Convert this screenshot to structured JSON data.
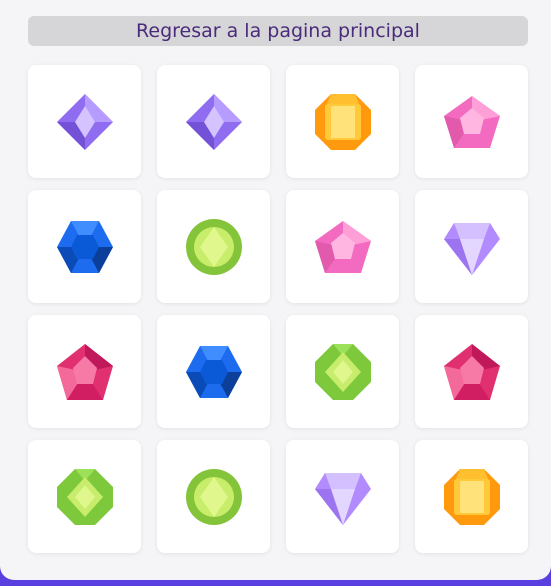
{
  "back_button": {
    "label": "Regresar a la pagina principal"
  },
  "colors": {
    "background": "#5a3fe0",
    "panel": "#f5f5f7",
    "button_bg": "#d6d6d8",
    "button_text": "#4a2a7a",
    "card": "#ffffff"
  },
  "cards": [
    {
      "gem": "purple-diamond-gem"
    },
    {
      "gem": "purple-diamond-gem"
    },
    {
      "gem": "orange-octagon-gem"
    },
    {
      "gem": "pink-pentagon-gem"
    },
    {
      "gem": "blue-hexagon-gem"
    },
    {
      "gem": "green-round-gem"
    },
    {
      "gem": "pink-pentagon-gem"
    },
    {
      "gem": "lavender-heart-gem"
    },
    {
      "gem": "crimson-pentagon-gem"
    },
    {
      "gem": "blue-hexagon-gem"
    },
    {
      "gem": "green-octagon-gem"
    },
    {
      "gem": "crimson-pentagon-gem"
    },
    {
      "gem": "green-octagon-gem"
    },
    {
      "gem": "green-round-gem"
    },
    {
      "gem": "lavender-heart-gem"
    },
    {
      "gem": "orange-octagon-gem"
    }
  ]
}
